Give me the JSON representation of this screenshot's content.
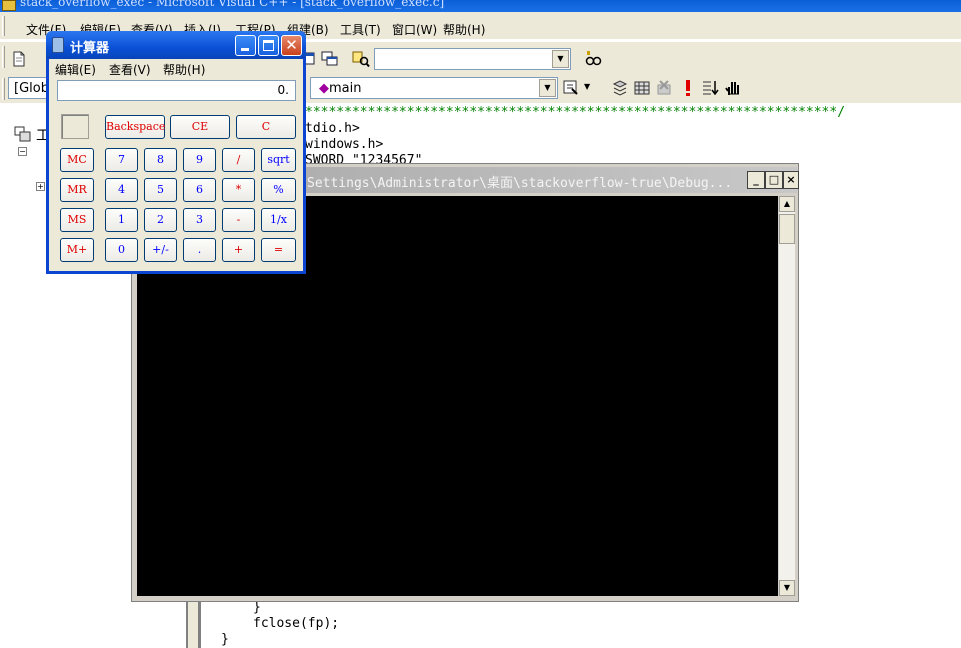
{
  "vc_window": {
    "title": "stack_overflow_exec - Microsoft Visual C++ - [stack_overflow_exec.c]",
    "menus": [
      "文件(F)",
      "编辑(E)",
      "查看(V)",
      "插入(I)",
      "工程(P)",
      "组建(B)",
      "工具(T)",
      "窗口(W)",
      "帮助(H)"
    ],
    "scope_combo": "[Glob",
    "function_combo": "main",
    "workspace_label": "工",
    "code_lines": {
      "stars": "********************************************************************/",
      "line1": "tdio.h>",
      "line2": "windows.h>",
      "line3": "SWORD \"1234567\"",
      "line_brace": "}",
      "line_fclose": "fclose(fp);",
      "line_end": "}"
    }
  },
  "console_window": {
    "title": "Settings\\Administrator\\桌面\\stackoverflow-true\\Debug..."
  },
  "calculator": {
    "title": "计算器",
    "menus": [
      "编辑(E)",
      "查看(V)",
      "帮助(H)"
    ],
    "display": "0.",
    "top_buttons": [
      "Backspace",
      "CE",
      "C"
    ],
    "memory_buttons": [
      "MC",
      "MR",
      "MS",
      "M+"
    ],
    "rows": [
      [
        "7",
        "8",
        "9",
        "/",
        "sqrt"
      ],
      [
        "4",
        "5",
        "6",
        "*",
        "%"
      ],
      [
        "1",
        "2",
        "3",
        "-",
        "1/x"
      ],
      [
        "0",
        "+/-",
        ".",
        "+",
        "="
      ]
    ]
  }
}
